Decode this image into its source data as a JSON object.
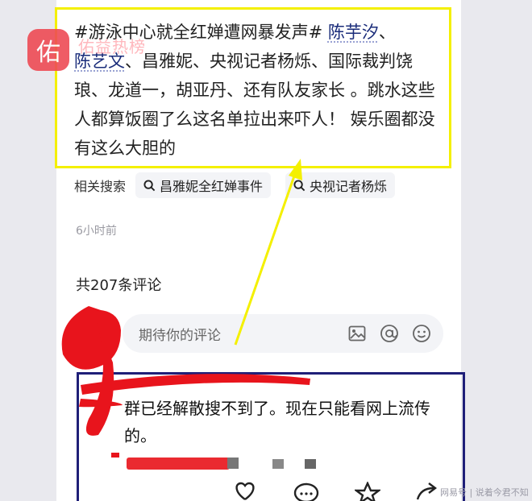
{
  "logo": {
    "mark": "佑",
    "text": "佑益热榜"
  },
  "post": {
    "tag": "#游泳中心就全红婵遭网暴发声#",
    "mention_1": "陈芋汐",
    "sep_1": "、",
    "mention_2": "陈艺文",
    "body": "、昌雅妮、央视记者杨烁、国际裁判饶琅、龙道一，胡亚丹、还有队友家长 。跳水这些人都算饭圈了么这名单拉出来吓人！ 娱乐圈都没有这么大胆的"
  },
  "related": {
    "label": "相关搜索",
    "chips": [
      "昌雅妮全红婵事件",
      "央视记者杨烁"
    ]
  },
  "time_ago": "6小时前",
  "comments": {
    "count_label": "共207条评论",
    "placeholder": "期待你的评论",
    "first_comment": "群已经解散搜不到了。现在只能看网上流传的。"
  },
  "watermark": "网易号 | 说着今君不知",
  "colors": {
    "highlight_yellow": "#f4f000",
    "highlight_blue": "#1f1f78",
    "scribble_red": "#e8141c",
    "link": "#1a2c7a"
  },
  "icons": [
    "image-icon",
    "at-icon",
    "emoji-icon",
    "search-icon",
    "heart-icon",
    "comment-icon",
    "star-icon",
    "share-icon"
  ]
}
